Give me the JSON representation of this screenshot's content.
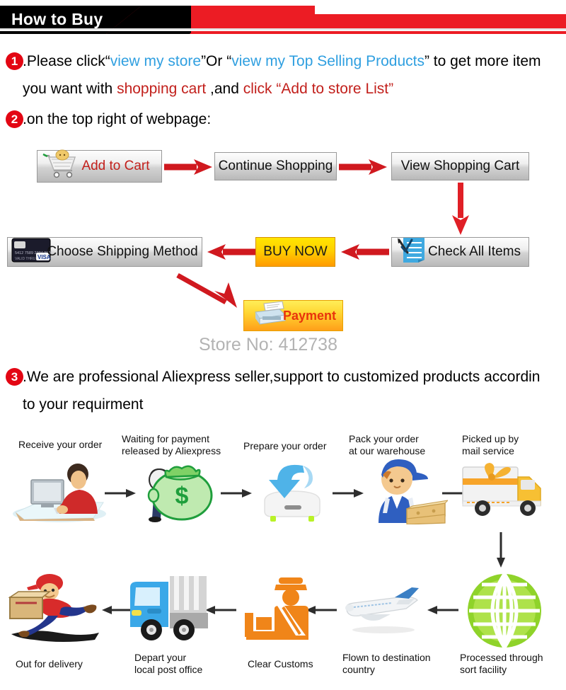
{
  "header": {
    "title": "How to Buy",
    "colors": {
      "black": "#000000",
      "red": "#ec1c24"
    }
  },
  "steps": [
    {
      "number": "1",
      "line1": [
        {
          "text": ".Please click“",
          "color": "black"
        },
        {
          "text": "view my store",
          "color": "blue"
        },
        {
          "text": "”Or “",
          "color": "black"
        },
        {
          "text": "view my Top Selling Products",
          "color": "blue"
        },
        {
          "text": "” to get more item",
          "color": "black"
        }
      ],
      "line2": [
        {
          "text": "you want with ",
          "color": "black"
        },
        {
          "text": "shopping cart",
          "color": "red"
        },
        {
          "text": " ,and ",
          "color": "black"
        },
        {
          "text": "click “Add to store List”",
          "color": "red"
        }
      ]
    },
    {
      "number": "2",
      "line1": [
        {
          "text": ".on the top right of webpage:",
          "color": "black"
        }
      ]
    },
    {
      "number": "3",
      "line1": [
        {
          "text": ".We are professional Aliexpress seller,support to customized products accordin",
          "color": "black"
        }
      ],
      "line2": [
        {
          "text": "to your requirment",
          "color": "black"
        }
      ]
    }
  ],
  "buttons": {
    "add_to_cart": {
      "label": "Add to Cart",
      "icon": "shopping-cart-icon"
    },
    "continue_shopping": {
      "label": "Continue Shopping"
    },
    "view_shopping_cart": {
      "label": "View Shopping Cart"
    },
    "choose_shipping_method": {
      "label": "Choose Shipping Method",
      "icon": "credit-card-icon",
      "card_brand": "VISA"
    },
    "buy_now": {
      "label": "BUY NOW"
    },
    "check_all_items": {
      "label": "Check All Items",
      "icon": "checklist-icon"
    },
    "payment": {
      "label": "Payment",
      "icon": "cash-register-icon"
    }
  },
  "store": {
    "label": "Store No: 412738"
  },
  "flow": {
    "row1": [
      {
        "label": "Receive your order",
        "icon": "person-at-computer-icon"
      },
      {
        "label": "Waiting for payment\nreleased by Aliexpress",
        "icon": "money-bag-icon"
      },
      {
        "label": "Prepare your order",
        "icon": "download-arrow-icon"
      },
      {
        "label": "Pack your order\nat our warehouse",
        "icon": "warehouse-worker-icon"
      },
      {
        "label": "Picked up by\nmail service",
        "icon": "delivery-truck-icon"
      }
    ],
    "row2": [
      {
        "label": "Out for delivery",
        "icon": "running-courier-icon"
      },
      {
        "label": "Depart your\nlocal post office",
        "icon": "post-truck-icon"
      },
      {
        "label": "Clear Customs",
        "icon": "customs-officer-icon"
      },
      {
        "label": "Flown to destination\ncountry",
        "icon": "airplane-icon"
      },
      {
        "label": "Processed through\nsort facility",
        "icon": "globe-icon"
      }
    ]
  }
}
